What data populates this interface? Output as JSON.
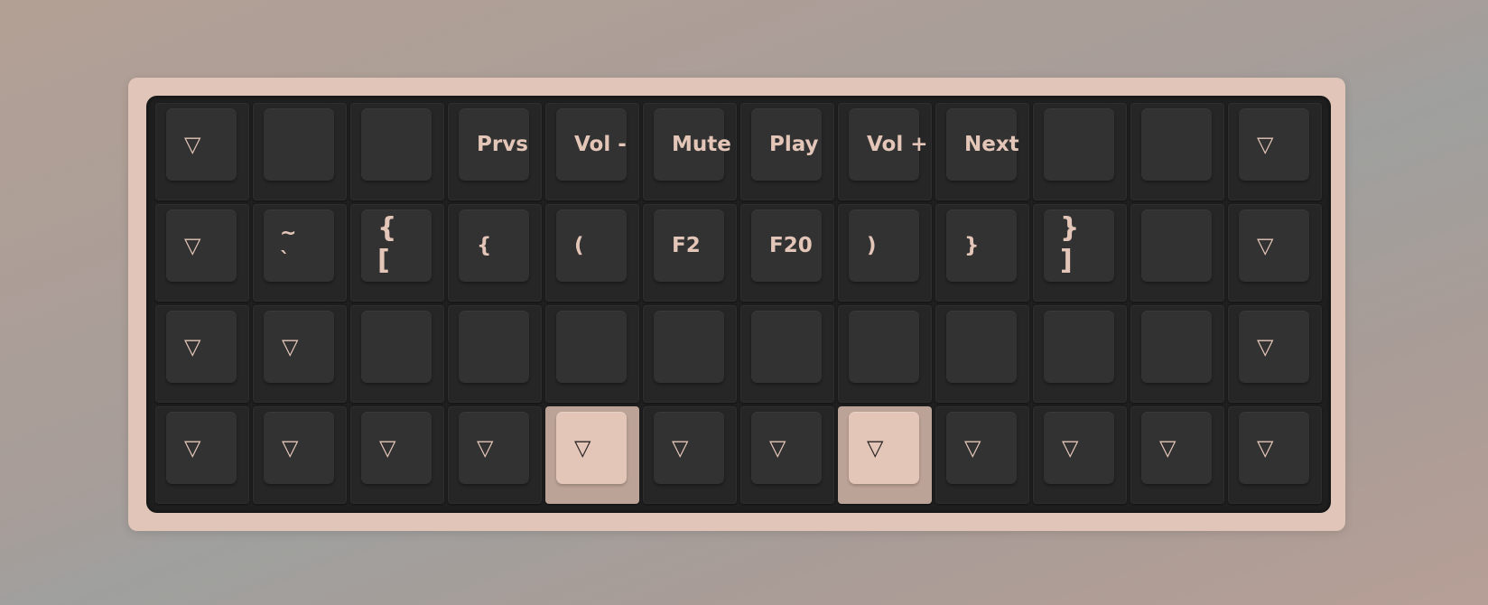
{
  "colors": {
    "case": "#e0c5b8",
    "plate": "#1f1f1f",
    "keycap": "#333232",
    "legend": "#e3c6b8",
    "accent_keycap": "#e3c6b8"
  },
  "icons": {
    "transparent": "▽"
  },
  "rows": [
    [
      {
        "type": "icon",
        "icon": "transparent-icon"
      },
      {
        "type": "blank"
      },
      {
        "type": "blank"
      },
      {
        "type": "text",
        "label": "Prvs"
      },
      {
        "type": "text",
        "label": "Vol -"
      },
      {
        "type": "text",
        "label": "Mute"
      },
      {
        "type": "text",
        "label": "Play"
      },
      {
        "type": "text",
        "label": "Vol +"
      },
      {
        "type": "text",
        "label": "Next"
      },
      {
        "type": "blank"
      },
      {
        "type": "blank"
      },
      {
        "type": "icon",
        "icon": "transparent-icon"
      }
    ],
    [
      {
        "type": "icon",
        "icon": "transparent-icon"
      },
      {
        "type": "dual",
        "top": "~",
        "bottom": "`",
        "small": true
      },
      {
        "type": "dual",
        "top": "{",
        "bottom": "["
      },
      {
        "type": "text",
        "label": "{"
      },
      {
        "type": "text",
        "label": "("
      },
      {
        "type": "text",
        "label": "F2"
      },
      {
        "type": "text",
        "label": "F20"
      },
      {
        "type": "text",
        "label": ")"
      },
      {
        "type": "text",
        "label": "}"
      },
      {
        "type": "dual",
        "top": "}",
        "bottom": "]"
      },
      {
        "type": "blank"
      },
      {
        "type": "icon",
        "icon": "transparent-icon"
      }
    ],
    [
      {
        "type": "icon",
        "icon": "transparent-icon"
      },
      {
        "type": "icon",
        "icon": "transparent-icon"
      },
      {
        "type": "blank"
      },
      {
        "type": "blank"
      },
      {
        "type": "blank"
      },
      {
        "type": "blank"
      },
      {
        "type": "blank"
      },
      {
        "type": "blank"
      },
      {
        "type": "blank"
      },
      {
        "type": "blank"
      },
      {
        "type": "blank"
      },
      {
        "type": "icon",
        "icon": "transparent-icon"
      }
    ],
    [
      {
        "type": "icon",
        "icon": "transparent-icon"
      },
      {
        "type": "icon",
        "icon": "transparent-icon"
      },
      {
        "type": "icon",
        "icon": "transparent-icon"
      },
      {
        "type": "icon",
        "icon": "transparent-icon"
      },
      {
        "type": "icon",
        "icon": "transparent-icon",
        "accent": true
      },
      {
        "type": "icon",
        "icon": "transparent-icon"
      },
      {
        "type": "icon",
        "icon": "transparent-icon"
      },
      {
        "type": "icon",
        "icon": "transparent-icon",
        "accent": true
      },
      {
        "type": "icon",
        "icon": "transparent-icon"
      },
      {
        "type": "icon",
        "icon": "transparent-icon"
      },
      {
        "type": "icon",
        "icon": "transparent-icon"
      },
      {
        "type": "icon",
        "icon": "transparent-icon"
      }
    ]
  ]
}
